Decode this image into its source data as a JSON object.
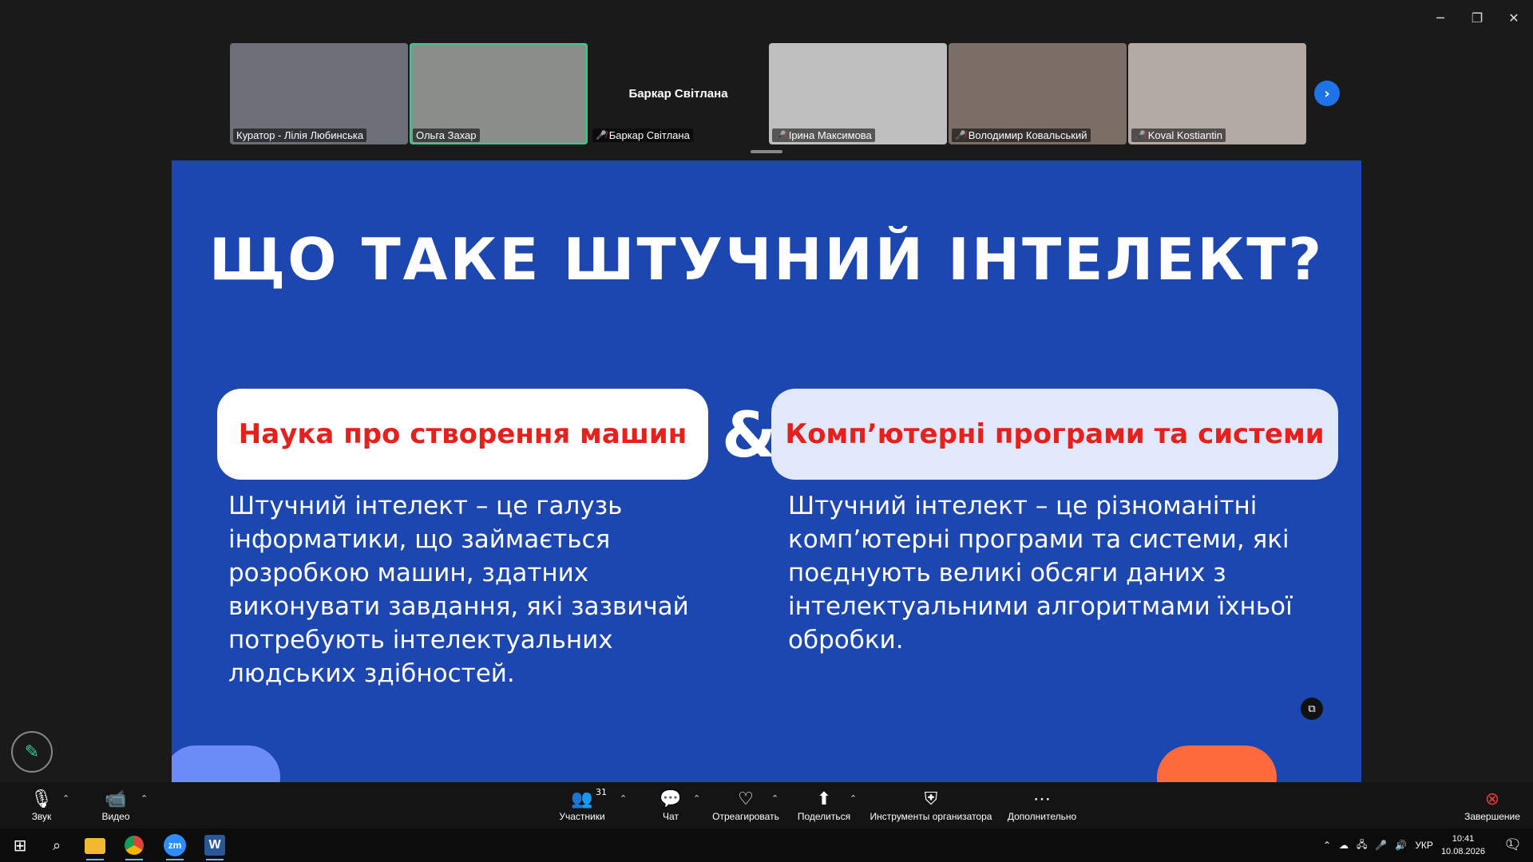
{
  "participants_strip": {
    "tiles": [
      {
        "name": "Куратор - Лілія Любинська",
        "muted": false,
        "active": false,
        "video": true,
        "bg": "#6c6f78"
      },
      {
        "name": "Ольга Захар",
        "muted": false,
        "active": true,
        "video": true,
        "bg": "#8a8f8c"
      },
      {
        "name": "Баркар Світлана",
        "muted": true,
        "active": false,
        "video": false,
        "big_name": "Баркар Світлана"
      },
      {
        "name": "Ірина Максимова",
        "muted": true,
        "active": false,
        "video": true,
        "bg": "#bfbfbf"
      },
      {
        "name": "Володимир Ковальський",
        "muted": true,
        "active": false,
        "video": true,
        "bg": "#7a6e66"
      },
      {
        "name": "Koval Kostiantin",
        "muted": true,
        "active": false,
        "video": true,
        "bg": "#b3aaa4"
      }
    ],
    "next_icon": "chevron-right-icon"
  },
  "slide": {
    "title": "ЩО ТАКЕ ШТУЧНИЙ ІНТЕЛЕКТ?",
    "left_card": "Наука про створення машин",
    "ampersand": "&",
    "right_card": "Комп’ютерні програми та системи",
    "left_text": "Штучний інтелект – це галузь інформатики, що займається розробкою машин, здатних виконувати завдання, які зазвичай потребують інтелектуальних людських здібностей.",
    "right_text": "Штучний інтелект – це різноманітні комп’ютерні програми та системи, які поєднують великі обсяги даних з інтелектуальними алгоритмами їхньої обробки."
  },
  "toolbar": {
    "audio": "Звук",
    "video": "Видео",
    "participants": "Участники",
    "participants_count": "31",
    "chat": "Чат",
    "react": "Отреагировать",
    "share": "Поделиться",
    "host_tools": "Инструменты организатора",
    "more": "Дополнительно",
    "end": "Завершение"
  },
  "taskbar": {
    "lang": "УКР",
    "time": "10:41",
    "date": "10.08.2026",
    "notifications_count": "1"
  }
}
